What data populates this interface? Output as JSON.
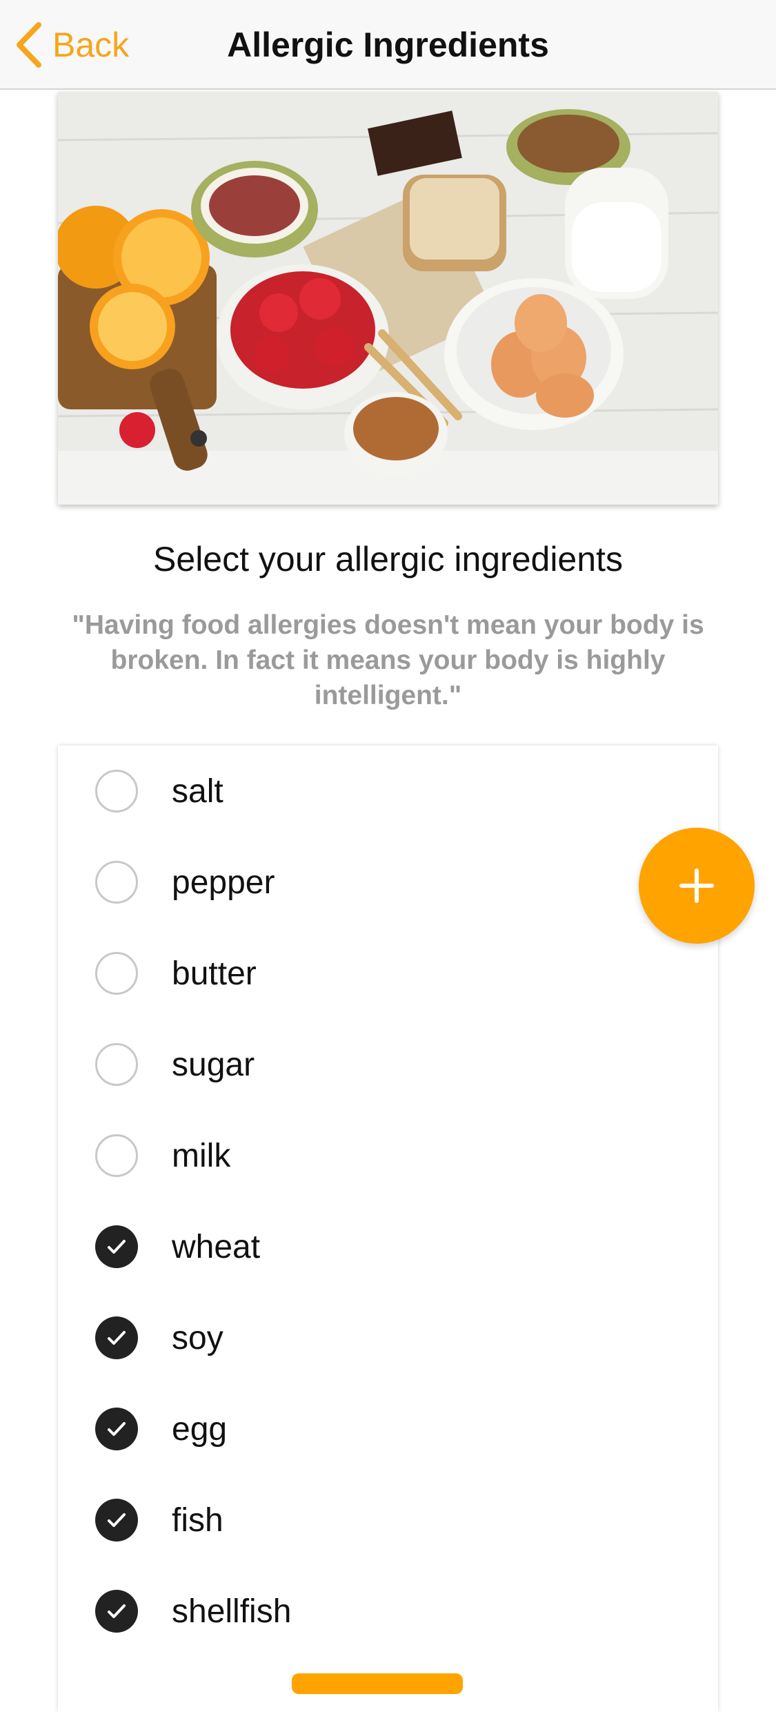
{
  "navbar": {
    "back_label": "Back",
    "title": "Allergic Ingredients",
    "back_icon": "chevron-left-icon"
  },
  "content": {
    "heading": "Select your allergic ingredients",
    "quote": "\"Having food allergies doesn't mean your body is broken. In fact it means your body is highly intelligent.\""
  },
  "ingredients": [
    {
      "label": "salt",
      "checked": false
    },
    {
      "label": "pepper",
      "checked": false
    },
    {
      "label": "butter",
      "checked": false
    },
    {
      "label": "sugar",
      "checked": false
    },
    {
      "label": "milk",
      "checked": false
    },
    {
      "label": "wheat",
      "checked": true
    },
    {
      "label": "soy",
      "checked": true
    },
    {
      "label": "egg",
      "checked": true
    },
    {
      "label": "fish",
      "checked": true
    },
    {
      "label": "shellfish",
      "checked": true
    }
  ],
  "fab": {
    "icon": "plus-icon"
  },
  "colors": {
    "accent": "#ffa301",
    "back_text": "#f7a51a",
    "checked_fill": "#222222",
    "quote_text": "#9a9a9a"
  }
}
